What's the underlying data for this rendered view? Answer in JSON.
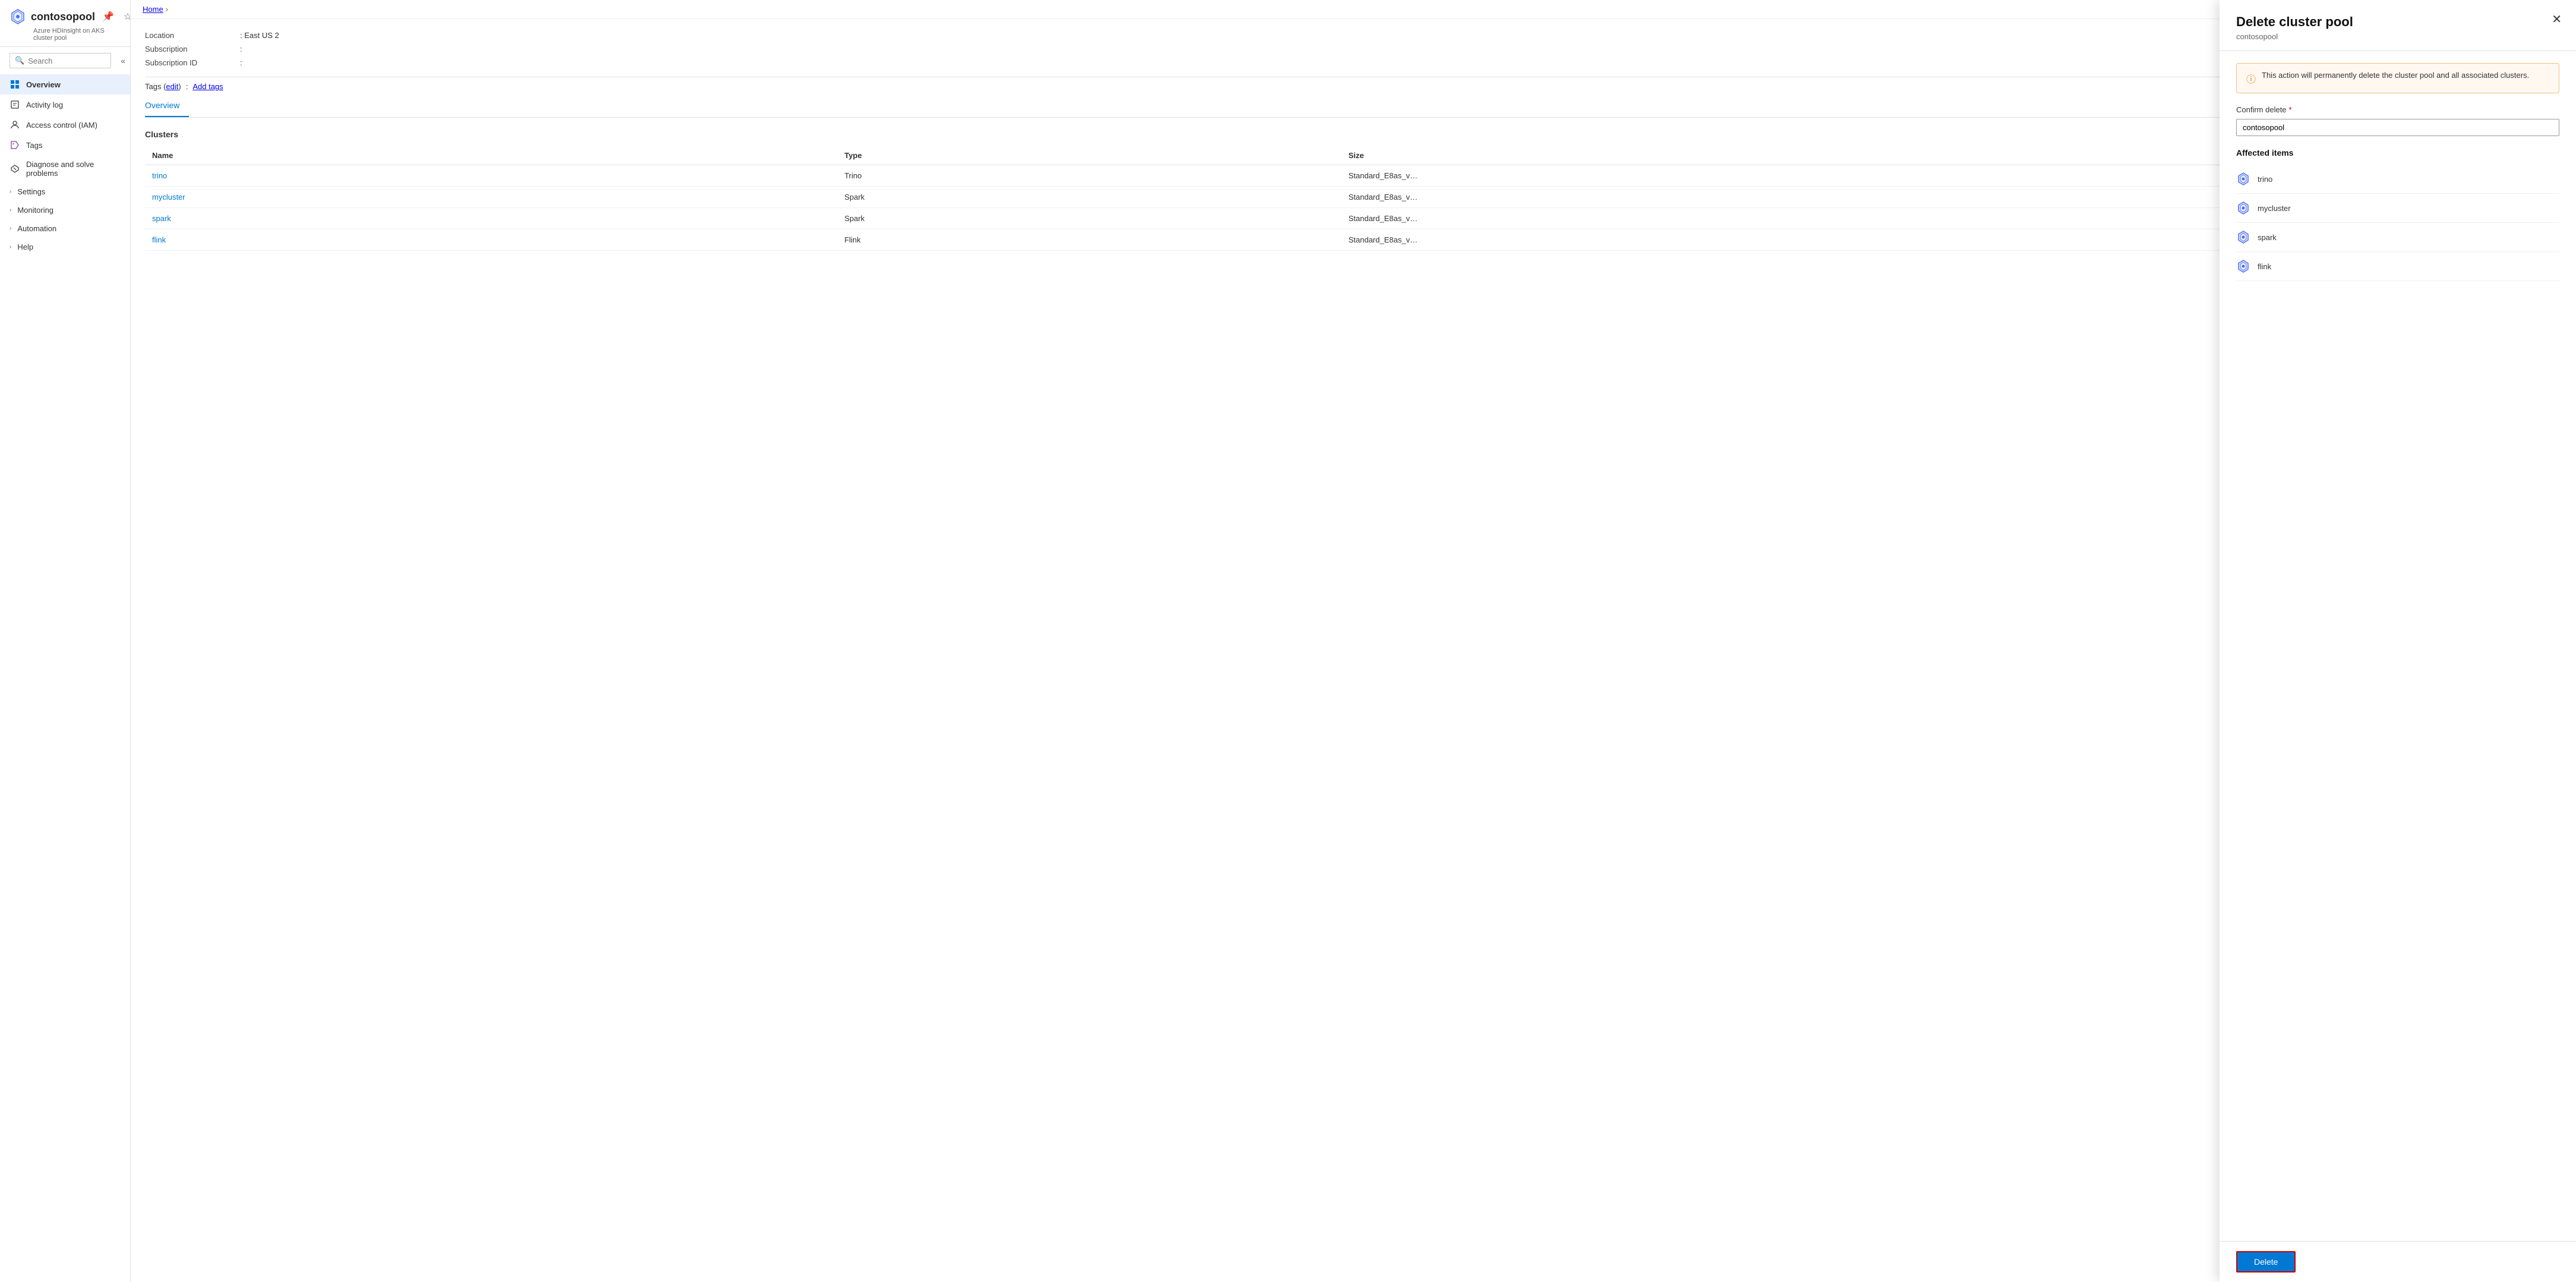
{
  "breadcrumb": {
    "home": "Home"
  },
  "sidebar": {
    "resource_name": "contosopool",
    "resource_subtitle": "Azure HDInsight on AKS cluster pool",
    "search_placeholder": "Search",
    "nav_items": [
      {
        "id": "overview",
        "label": "Overview",
        "active": true,
        "expandable": false
      },
      {
        "id": "activity-log",
        "label": "Activity log",
        "active": false,
        "expandable": false
      },
      {
        "id": "access-control",
        "label": "Access control (IAM)",
        "active": false,
        "expandable": false
      },
      {
        "id": "tags",
        "label": "Tags",
        "active": false,
        "expandable": false
      },
      {
        "id": "diagnose",
        "label": "Diagnose and solve problems",
        "active": false,
        "expandable": false
      },
      {
        "id": "settings",
        "label": "Settings",
        "active": false,
        "expandable": true
      },
      {
        "id": "monitoring",
        "label": "Monitoring",
        "active": false,
        "expandable": true
      },
      {
        "id": "automation",
        "label": "Automation",
        "active": false,
        "expandable": true
      },
      {
        "id": "help",
        "label": "Help",
        "active": false,
        "expandable": true
      }
    ]
  },
  "main": {
    "location_label": "Location",
    "location_value": "East US 2",
    "subscription_label": "Subscription",
    "subscription_value": "",
    "subscription_id_label": "Subscription ID",
    "subscription_id_value": "",
    "tags_label": "Tags (edit)",
    "tags_edit": "edit",
    "tags_add": "Add tags",
    "tab": "Overview",
    "clusters_section": "Clusters",
    "table_headers": [
      "Name",
      "Type",
      "Size"
    ],
    "clusters": [
      {
        "name": "trino",
        "type": "Trino",
        "size": "Standard_E8as_v"
      },
      {
        "name": "mycluster",
        "type": "Spark",
        "size": "Standard_E8as_v"
      },
      {
        "name": "spark",
        "type": "Spark",
        "size": "Standard_E8as_v"
      },
      {
        "name": "flink",
        "type": "Flink",
        "size": "Standard_E8as_v"
      }
    ]
  },
  "panel": {
    "title": "Delete cluster pool",
    "subtitle": "contosopool",
    "warning_text": "This action will permanently delete the cluster pool and all associated clusters.",
    "confirm_label": "Confirm delete",
    "confirm_placeholder": "",
    "confirm_value": "contosopool",
    "affected_title": "Affected items",
    "affected_items": [
      {
        "name": "trino"
      },
      {
        "name": "mycluster"
      },
      {
        "name": "spark"
      },
      {
        "name": "flink"
      }
    ],
    "delete_button": "Delete"
  }
}
